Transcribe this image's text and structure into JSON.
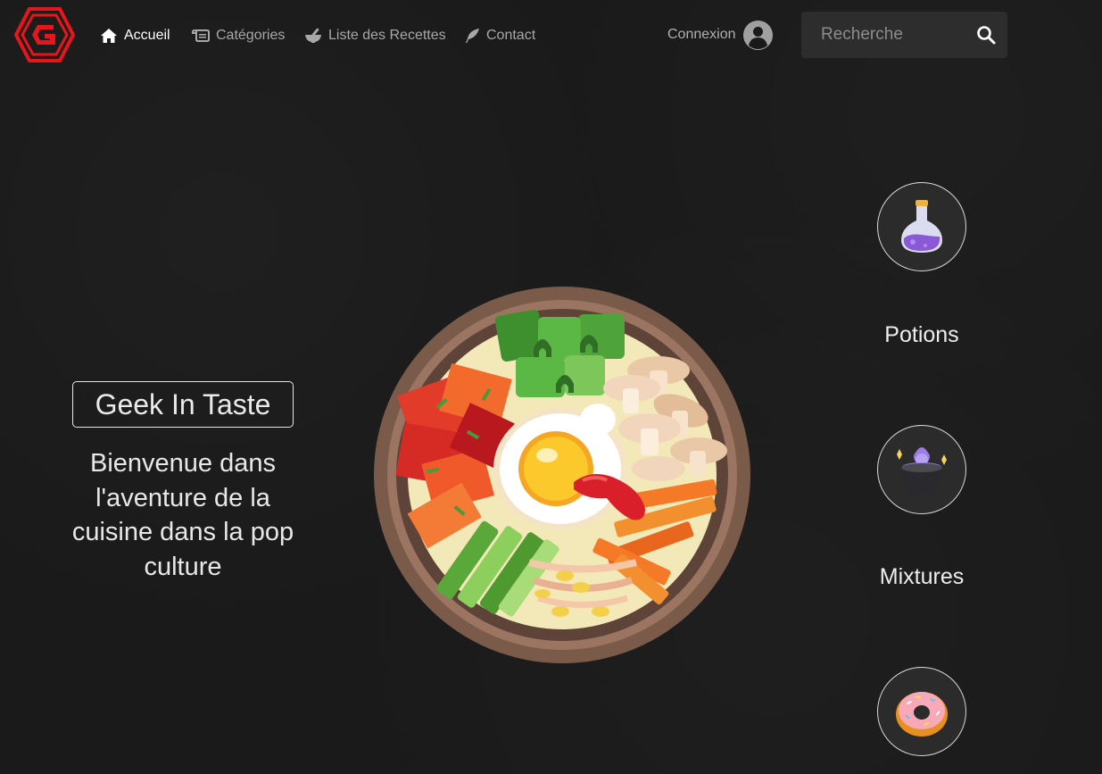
{
  "nav": {
    "logo_icon": "geek-in-taste-hexagon-logo",
    "items": [
      {
        "label": "Accueil",
        "icon": "home-icon",
        "active": true
      },
      {
        "label": "Catégories",
        "icon": "scroll-icon",
        "active": false
      },
      {
        "label": "Liste des Recettes",
        "icon": "mortar-icon",
        "active": false
      },
      {
        "label": "Contact",
        "icon": "quill-icon",
        "active": false
      }
    ],
    "login_label": "Connexion",
    "search": {
      "placeholder": "Recherche",
      "value": ""
    }
  },
  "hero": {
    "brand": "Geek In Taste",
    "tagline": "Bienvenue dans l'aventure de la cuisine dans la pop culture",
    "image_icon": "bibimbap-bowl-illustration"
  },
  "categories": [
    {
      "label": "Potions",
      "icon": "potion-flask-icon"
    },
    {
      "label": "Mixtures",
      "icon": "cauldron-icon"
    },
    {
      "label": "",
      "icon": "donut-icon"
    }
  ],
  "colors": {
    "background": "#1a1a1a",
    "logo_red": "#e8161b",
    "nav_active": "#ffffff",
    "nav_inactive": "#a8a8a8",
    "search_bg": "#2d2d2d"
  }
}
